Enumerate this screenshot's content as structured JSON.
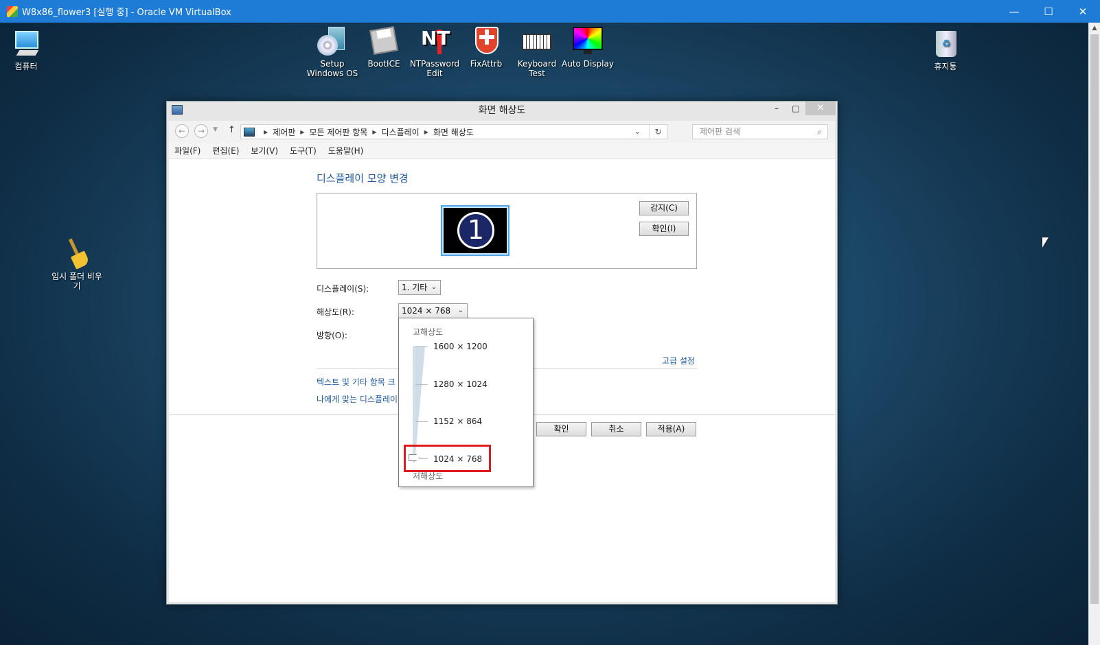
{
  "vbox": {
    "title": "W8x86_flower3 [실행 중] - Oracle VM VirtualBox",
    "minimize": "—",
    "maximize": "☐",
    "close": "✕"
  },
  "desktop_icons": {
    "computer": "컴퓨터",
    "setup": "Setup Windows OS",
    "bootice": "BootICE",
    "ntpassword": "NTPassword Edit",
    "fixattrb": "FixAttrb",
    "keyboard": "Keyboard Test",
    "autodisplay": "Auto Display",
    "recycle": "휴지통",
    "tempclean": "임시 폴더 비우기"
  },
  "window": {
    "title": "화면 해상도",
    "minimize": "–",
    "maximize": "□",
    "close": "✕",
    "breadcrumb": [
      "제어판",
      "모든 제어판 항목",
      "디스플레이",
      "화면 해상도"
    ],
    "search_placeholder": "제어판 검색",
    "menu": [
      "파일(F)",
      "편집(E)",
      "보기(V)",
      "도구(T)",
      "도움말(H)"
    ]
  },
  "display": {
    "heading": "디스플레이 모양 변경",
    "monitor_number": "1",
    "detect_button": "감지(C)",
    "identify_button": "확인(I)",
    "display_label": "디스플레이(S):",
    "display_value": "1. 기타",
    "resolution_label": "해상도(R):",
    "resolution_value": "1024 × 768",
    "orientation_label": "방향(O):",
    "advanced_link": "고급 설정",
    "link_text_size": "텍스트 및 기타 항목 크",
    "link_display_settings": "나에게 맞는 디스플레이",
    "ok_button": "확인",
    "cancel_button": "취소",
    "apply_button": "적용(A)"
  },
  "resolution_dropdown": {
    "high_label": "고해상도",
    "low_label": "저해상도",
    "options": [
      "1600 × 1200",
      "1280 × 1024",
      "1152 × 864",
      "1024 × 768"
    ],
    "selected": "1024 × 768"
  }
}
